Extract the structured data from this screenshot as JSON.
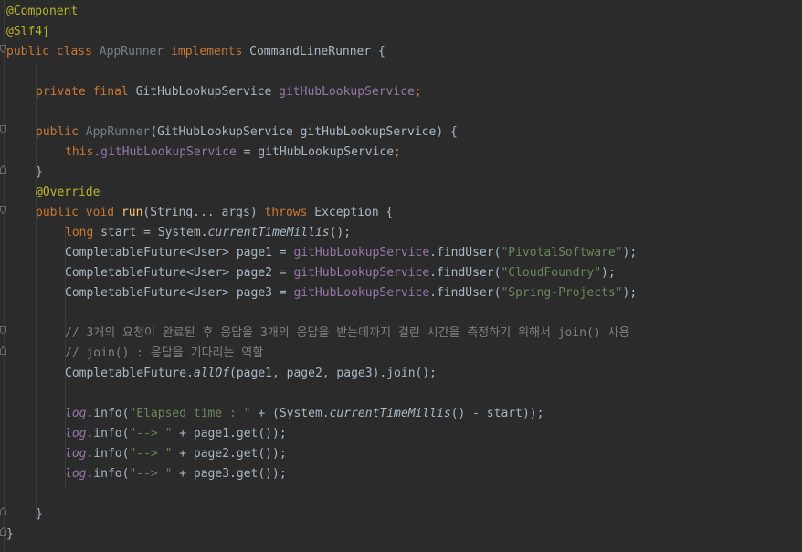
{
  "code": {
    "ann_component": "@Component",
    "ann_slf4j": "@Slf4j",
    "kw_public": "public",
    "kw_class": "class",
    "class_name": "AppRunner",
    "kw_implements": "implements",
    "iface": "CommandLineRunner",
    "brace_open": "{",
    "brace_close": "}",
    "kw_private": "private",
    "kw_final": "final",
    "type_service": "GitHubLookupService",
    "field_name": "gitHubLookupService",
    "semicolon": ";",
    "ctor_params": "(GitHubLookupService gitHubLookupService) {",
    "kw_this": "this",
    "dot": ".",
    "assign_rhs": " = gitHubLookupService",
    "ann_override": "@Override",
    "kw_void": "void",
    "method_run": "run",
    "run_params": "(String... args) ",
    "kw_throws": "throws",
    "run_tail": " Exception {",
    "kw_long": "long",
    "start_decl": " start = System.",
    "current_time": "currentTimeMillis",
    "call_end": "();",
    "future_decl1": "CompletableFuture<User> page1 = ",
    "future_decl2": "CompletableFuture<User> page2 = ",
    "future_decl3": "CompletableFuture<User> page3 = ",
    "find_user": ".findUser(",
    "str_pivotal": "\"PivotalSoftware\"",
    "str_cloud": "\"CloudFoundry\"",
    "str_spring": "\"Spring-Projects\"",
    "close_paren_semi": ");",
    "comment1": "// 3개의 요청이 완료된 후 응답을 3개의 응답을 받는데까지 걸린 시간을 측정하기 위해서 join() 사용",
    "comment2": "// join() : 응답을 기다리는 역할",
    "future_class": "CompletableFuture.",
    "all_of": "allOf",
    "all_of_args": "(page1, page2, page3).join();",
    "log": "log",
    "info_open": ".info(",
    "str_elapsed": "\"Elapsed time : \"",
    "elapsed_mid": " + (System.",
    "elapsed_end": "() - start));",
    "str_arrow": "\"--> \"",
    "get1": " + page1.get());",
    "get2": " + page2.get());",
    "get3": " + page3.get());"
  }
}
